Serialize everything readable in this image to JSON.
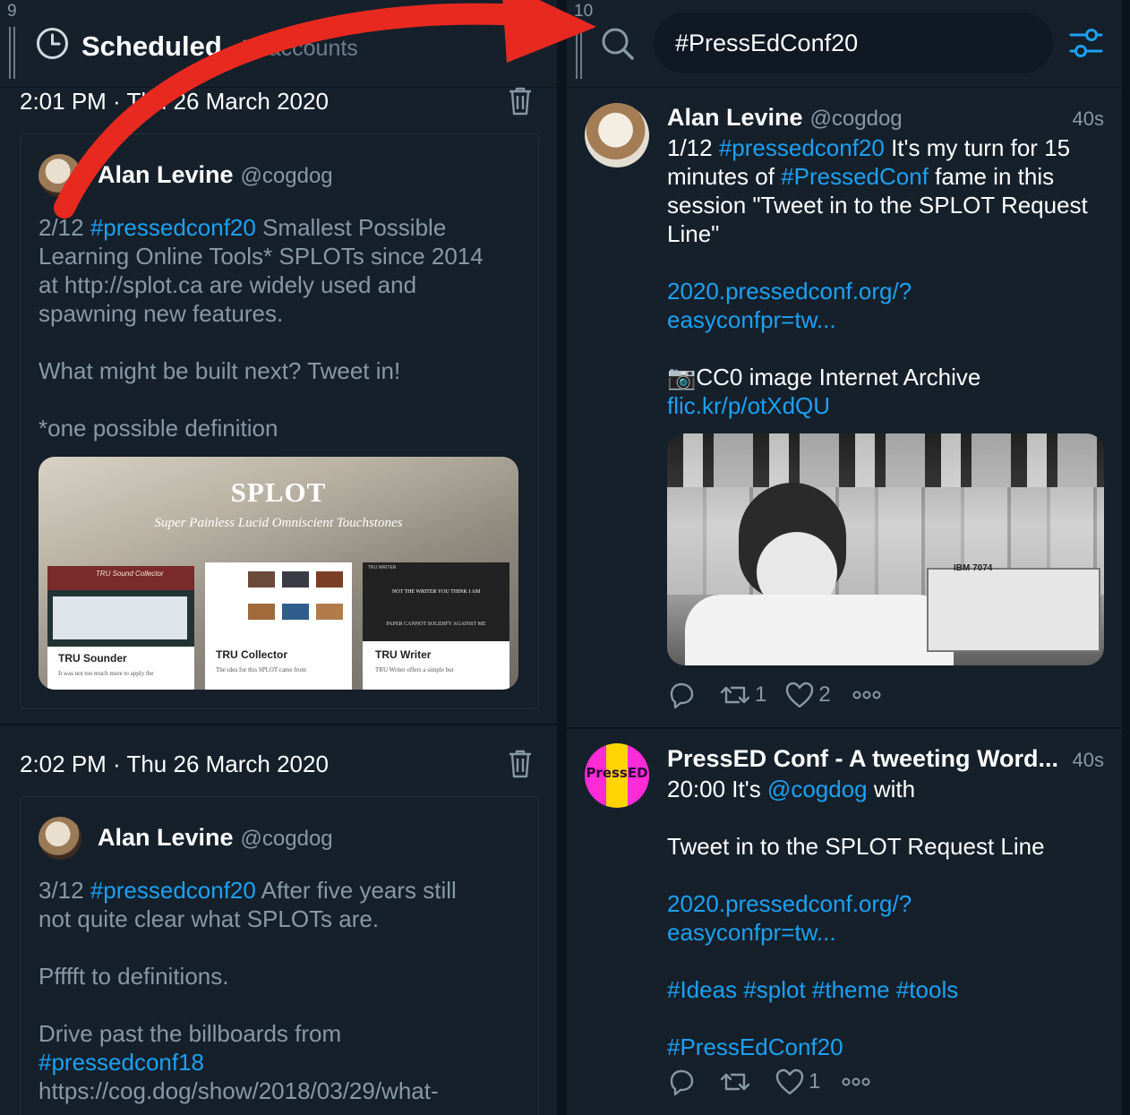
{
  "left_column": {
    "index": "9",
    "title": "Scheduled",
    "subtitle": "All accounts",
    "tweets": [
      {
        "time": "2:01 PM · Thu 26 March 2020",
        "name": "Alan Levine",
        "handle": "@cogdog",
        "text_prefix": "2/12 ",
        "hashtag": "#pressedconf20",
        "text_line1_rest": " Smallest Possible",
        "text_lines": [
          "Learning Online Tools* SPLOTs since 2014",
          "at  http://splot.ca are widely used and",
          "spawning new features."
        ],
        "text_para2": "What might be built next? Tweet in!",
        "text_para3": "*one possible definition",
        "image": {
          "title": "SPLOT",
          "subtitle": "Super Painless Lucid Omniscient Touchstones",
          "tiles": [
            {
              "label": "TRU Sounder",
              "caption": "It was not too much more to apply the",
              "header": "TRU Sound Collector"
            },
            {
              "label": "TRU Collector",
              "caption": "The idea for this SPLOT came from",
              "header": ""
            },
            {
              "label": "TRU Writer",
              "caption": "TRU Writer offers a simple but",
              "header": "TRU WRITER",
              "banner1": "NOT THE WRITER YOU THINK I AM",
              "banner2": "PAPER CANNOT SOLIDIFY AGAINST ME"
            }
          ]
        }
      },
      {
        "time": "2:02 PM · Thu 26 March 2020",
        "name": "Alan Levine",
        "handle": "@cogdog",
        "text_prefix": "3/12 ",
        "hashtag": "#pressedconf20",
        "text_line1_rest": " After five years still",
        "text_line2": "not quite clear what SPLOTs are.",
        "text_para2": "Pfffft to definitions.",
        "text_para3": "Drive past the billboards from",
        "hashtag2": "#pressedconf18",
        "text_link": " https://cog.dog/show/2018/03/29/what-"
      }
    ]
  },
  "right_column": {
    "index": "10",
    "search_value": "#PressEdConf20",
    "tweets": [
      {
        "name": "Alan Levine",
        "handle": "@cogdog",
        "age": "40s",
        "l1_pre": "1/12 ",
        "l1_tag": "#pressedconf20",
        "l1_post": " It's my turn for 15",
        "l2_pre": "minutes of ",
        "l2_tag": "#PressedConf",
        "l2_post": " fame in this",
        "l3": "session \"Tweet in to the SPLOT Request",
        "l4": "Line\"",
        "link1": "2020.pressedconf.org/?",
        "link2": "easyconfpr=tw...",
        "camera": "📷",
        "image_credit": "CC0 image Internet Archive",
        "flickr": "flic.kr/p/otXdQU",
        "photo_label": "IBM 7074",
        "retweets": "1",
        "likes": "2"
      },
      {
        "name": "PressED Conf - A tweeting Word...",
        "age": "40s",
        "avatar_text": "PressED",
        "l1_pre": "20:00 It's ",
        "l1_mention": "@cogdog",
        "l1_post": " with",
        "l2": "Tweet in to the SPLOT Request Line",
        "link1": "2020.pressedconf.org/?",
        "link2": "easyconfpr=tw...",
        "tags": "#Ideas #splot #theme #tools",
        "tag_last": "#PressEdConf20",
        "likes": "1"
      }
    ]
  },
  "colors": {
    "bg": "#15202b",
    "accent": "#1da1f2",
    "muted": "#8899a6",
    "arrow": "#e8291f"
  },
  "icons": [
    "clock-icon",
    "trash-icon",
    "search-icon",
    "filter-settings-icon",
    "reply-icon",
    "retweet-icon",
    "like-icon",
    "more-icon"
  ]
}
